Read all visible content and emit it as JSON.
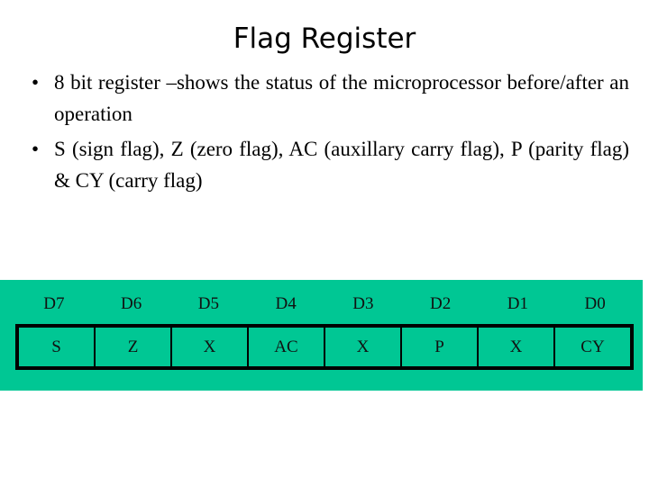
{
  "slide": {
    "title": "Flag Register",
    "bullets": [
      {
        "marker": "•",
        "text": "8 bit register –shows the status of the microprocessor before/after an operation"
      },
      {
        "marker": "•",
        "text": "S (sign flag), Z (zero flag), AC (auxillary carry flag), P (parity flag) & CY (carry flag)"
      }
    ]
  },
  "register": {
    "panel_color": "#00C794",
    "bit_labels": [
      "D7",
      "D6",
      "D5",
      "D4",
      "D3",
      "D2",
      "D1",
      "D0"
    ],
    "cells": [
      "S",
      "Z",
      "X",
      "AC",
      "X",
      "P",
      "X",
      "CY"
    ]
  }
}
